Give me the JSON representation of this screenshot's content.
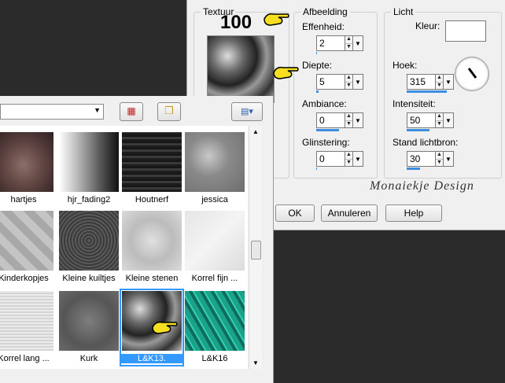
{
  "dialog": {
    "texture": {
      "label": "Textuur"
    },
    "image_group": {
      "label": "Afbeelding",
      "fields": [
        {
          "label": "Effenheid:",
          "value": "2",
          "bar": 0.02
        },
        {
          "label": "Diepte:",
          "value": "5",
          "bar": 0.05
        },
        {
          "label": "Ambiance:",
          "value": "0",
          "bar": 0.5
        },
        {
          "label": "Glinstering:",
          "value": "0",
          "bar": 0
        }
      ]
    },
    "light_group": {
      "label": "Licht",
      "color_label": "Kleur:",
      "fields": [
        {
          "label": "Hoek:",
          "value": "315",
          "bar": 0.88
        },
        {
          "label": "Intensiteit:",
          "value": "50",
          "bar": 0.5
        },
        {
          "label": "Stand lichtbron:",
          "value": "30",
          "bar": 0.3
        }
      ]
    },
    "buttons": {
      "ok": "OK",
      "cancel": "Annuleren",
      "help": "Help"
    },
    "callout_number": "100",
    "watermark": "Monaiekje Design"
  },
  "browser": {
    "items": [
      {
        "label": "hartjes"
      },
      {
        "label": "hjr_fading2"
      },
      {
        "label": "Houtnerf"
      },
      {
        "label": "jessica"
      },
      {
        "label": "Kinderkopjes"
      },
      {
        "label": "Kleine kuiltjes"
      },
      {
        "label": "Kleine stenen"
      },
      {
        "label": "Korrel fijn ..."
      },
      {
        "label": "Korrel lang ..."
      },
      {
        "label": "Kurk"
      },
      {
        "label": "L&K13."
      },
      {
        "label": "L&K16"
      }
    ],
    "selected_index": 10
  },
  "colors": {
    "accent": "#3b8ee0",
    "selection": "#3399ff"
  },
  "icons": [
    "pointing-hand-icon",
    "folder-icon",
    "view-toggle-icon",
    "texture-presets-icon",
    "dial-icon"
  ]
}
